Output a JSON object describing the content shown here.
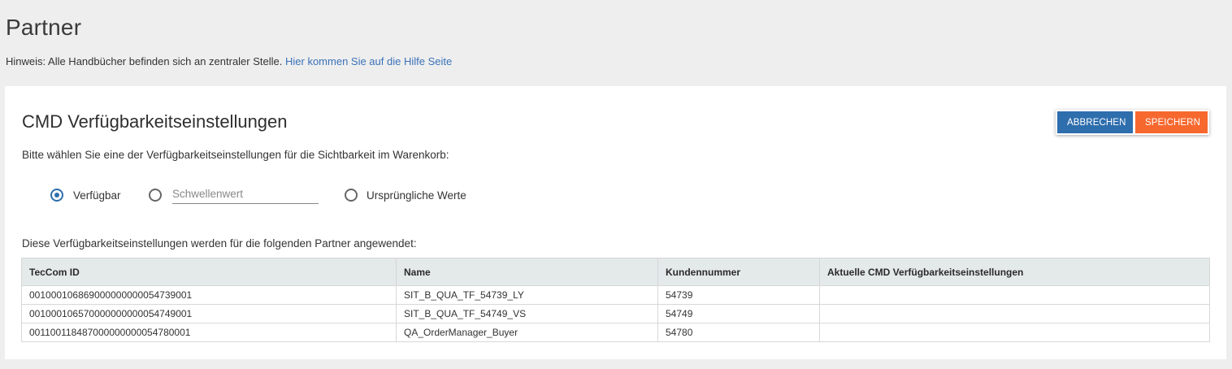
{
  "page": {
    "title": "Partner",
    "hint_text": "Hinweis: Alle Handbücher befinden sich an zentraler Stelle.",
    "hint_link": "Hier kommen Sie auf die Hilfe Seite"
  },
  "card": {
    "title": "CMD Verfügbarkeitseinstellungen",
    "cancel_label": "ABBRECHEN",
    "save_label": "SPEICHERN",
    "instruction": "Bitte wählen Sie eine der Verfügbarkeitseinstellungen für die Sichtbarkeit im Warenkorb:",
    "options": {
      "available_label": "Verfügbar",
      "threshold_placeholder": "Schwellenwert",
      "threshold_value": "",
      "original_label": "Ursprüngliche Werte",
      "selected": "Verfügbar"
    },
    "applies_text": "Diese Verfügbarkeitseinstellungen werden für die folgenden Partner angewendet:"
  },
  "table": {
    "headers": [
      "TecCom ID",
      "Name",
      "Kundennummer",
      "Aktuelle CMD Verfügbarkeitseinstellungen"
    ],
    "rows": [
      [
        "001000106869000000000054739001",
        "SIT_B_QUA_TF_54739_LY",
        "54739",
        ""
      ],
      [
        "001000106570000000000054749001",
        "SIT_B_QUA_TF_54749_VS",
        "54749",
        ""
      ],
      [
        "001100118487000000000054780001",
        "QA_OrderManager_Buyer",
        "54780",
        ""
      ]
    ]
  },
  "colors": {
    "primary": "#2e6ead",
    "save": "#f7682f",
    "link": "#3a72b8"
  }
}
